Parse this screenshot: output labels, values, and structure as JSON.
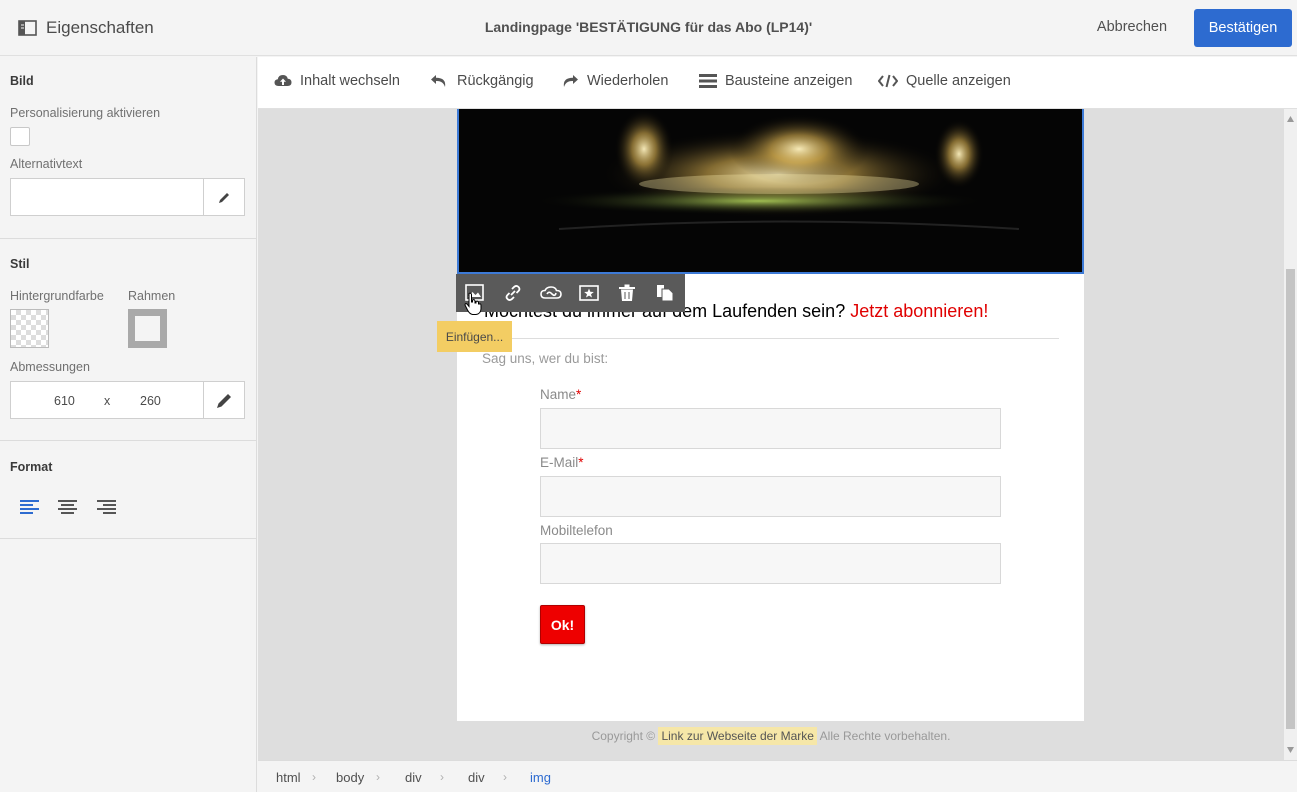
{
  "topbar": {
    "properties_label": "Eigenschaften",
    "title": "Landingpage 'BESTÄTIGUNG für das Abo (LP14)'",
    "cancel_label": "Abbrechen",
    "confirm_label": "Bestätigen"
  },
  "left_panel": {
    "image_section": {
      "title": "Bild",
      "personalization_label": "Personalisierung aktivieren",
      "personalization_checked": false,
      "alt_text_label": "Alternativtext",
      "alt_text_value": ""
    },
    "style_section": {
      "title": "Stil",
      "background_label": "Hintergrundfarbe",
      "border_label": "Rahmen",
      "dimensions_label": "Abmessungen",
      "width": "610",
      "separator": "x",
      "height": "260"
    },
    "format_section": {
      "title": "Format",
      "alignment": [
        "left",
        "center",
        "right"
      ],
      "selected_alignment": "left"
    }
  },
  "toolbar": {
    "change_content": "Inhalt wechseln",
    "undo": "Rückgängig",
    "redo": "Wiederholen",
    "show_blocks": "Bausteine anzeigen",
    "show_source": "Quelle anzeigen"
  },
  "page": {
    "heading_text": "Möchtest du immer auf dem Laufenden sein?",
    "heading_cta": "Jetzt abonnieren!",
    "intro": "Sag uns, wer du bist:",
    "fields": [
      {
        "label": "Name",
        "required": "*"
      },
      {
        "label": "E-Mail",
        "required": "*"
      },
      {
        "label": "Mobiltelefon",
        "required": ""
      }
    ],
    "ok_label": "Ok!",
    "footer_prefix": "Copyright ©",
    "footer_link": "Link zur Webseite der Marke",
    "footer_suffix": "Alle Rechte vorbehalten."
  },
  "image_toolbar": {
    "tooltip": "Einfügen...",
    "tools": [
      "insert-image-icon",
      "link-icon",
      "creative-cloud-icon",
      "image-star-icon",
      "trash-icon",
      "copy-icon"
    ]
  },
  "breadcrumb": [
    "html",
    "body",
    "div",
    "div",
    "img"
  ],
  "colors": {
    "accent": "#2d6bd0",
    "cta_red": "#e00000",
    "tooltip_yellow": "#f3cd63"
  }
}
